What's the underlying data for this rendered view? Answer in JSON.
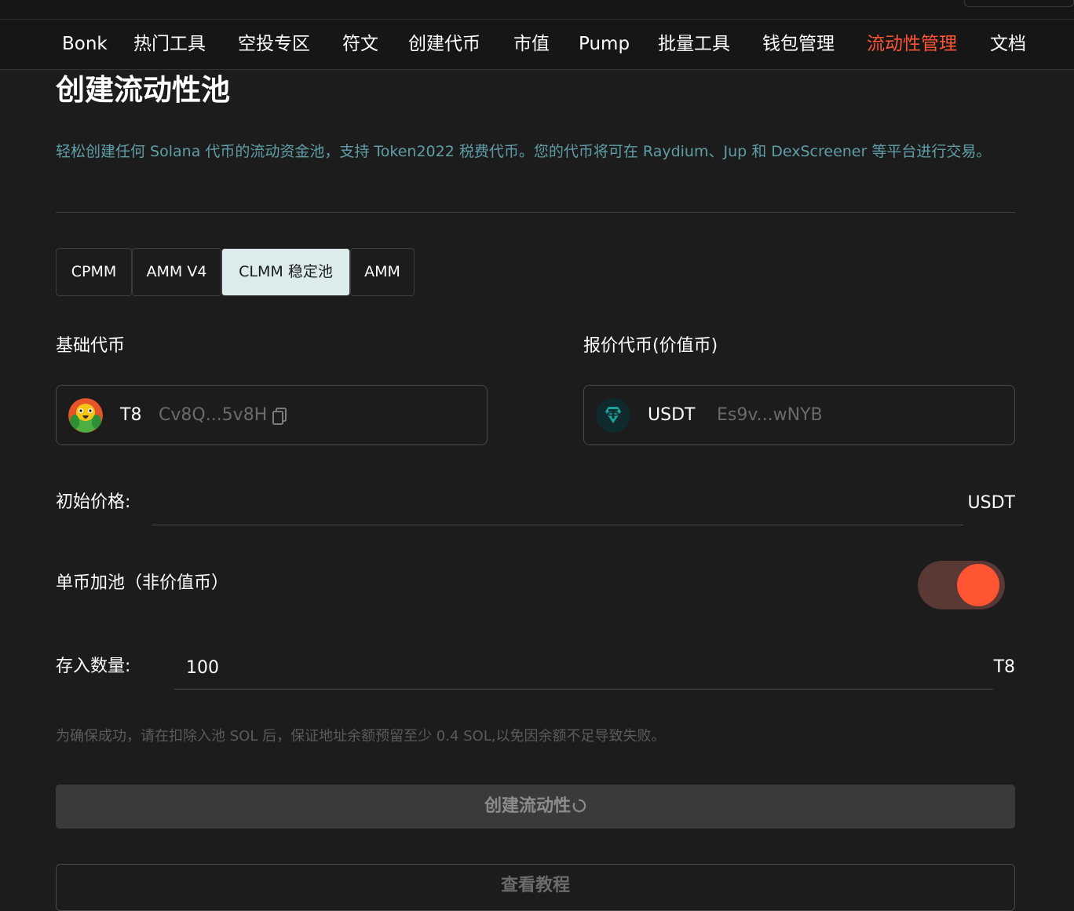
{
  "nav": {
    "items": [
      {
        "label": "Bonk"
      },
      {
        "label": "热门工具"
      },
      {
        "label": "空投专区"
      },
      {
        "label": "符文"
      },
      {
        "label": "创建代币"
      },
      {
        "label": "市值"
      },
      {
        "label": "Pump"
      },
      {
        "label": "批量工具"
      },
      {
        "label": "钱包管理"
      },
      {
        "label": "流动性管理",
        "active": true
      },
      {
        "label": "文档"
      }
    ]
  },
  "page": {
    "title": "创建流动性池",
    "description": "轻松创建任何 Solana 代币的流动资金池，支持 Token2022 税费代币。您的代币将可在 Raydium、Jup 和 DexScreener 等平台进行交易。"
  },
  "pool_types": [
    {
      "label": "CPMM"
    },
    {
      "label": "AMM V4"
    },
    {
      "label": "CLMM 稳定池",
      "selected": true
    },
    {
      "label": "AMM"
    }
  ],
  "base_token": {
    "label": "基础代币",
    "symbol": "T8",
    "address_short": "Cv8Q...5v8H",
    "logo_icon": "parrot-logo-icon"
  },
  "quote_token": {
    "label": "报价代币(价值币)",
    "symbol": "USDT",
    "address_short": "Es9v...wNYB",
    "logo_icon": "tether-logo-icon"
  },
  "initial_price": {
    "label": "初始价格:",
    "value": "",
    "unit": "USDT"
  },
  "single_side": {
    "label": "单币加池（非价值币）",
    "enabled": true
  },
  "deposit": {
    "label": "存入数量:",
    "value": "100",
    "unit": "T8"
  },
  "note": "为确保成功，请在扣除入池 SOL 后，保证地址余额预留至少 0.4 SOL,以免因余额不足导致失败。",
  "buttons": {
    "create": "创建流动性",
    "tutorial": "查看教程"
  },
  "colors": {
    "accent": "#ff5533",
    "background": "#1c1c1c",
    "description": "#5f9ea8",
    "selected_tab_bg": "#dcecec"
  }
}
